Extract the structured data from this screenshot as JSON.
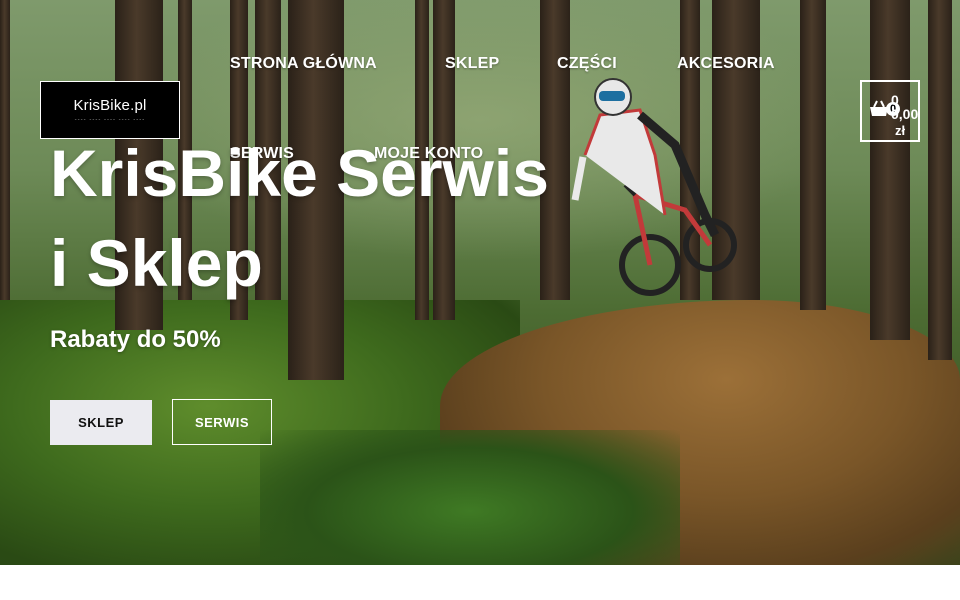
{
  "header": {
    "logo_text": "KrisBike.pl",
    "logo_tagline": "---- ---- ---- ---- ----"
  },
  "nav": {
    "items": [
      {
        "label": "STRONA GŁÓWNA"
      },
      {
        "label": "SKLEP"
      },
      {
        "label": "CZĘŚCI"
      },
      {
        "label": "AKCESORIA"
      },
      {
        "label": "SERWIS"
      },
      {
        "label": "MOJE KONTO"
      }
    ]
  },
  "cart": {
    "count": "0",
    "amount_top": "0",
    "amount": "0,00",
    "currency": "zł",
    "icon": "shopping-basket-icon"
  },
  "hero": {
    "title": "KrisBike Serwis i Sklep",
    "subtitle": "Rabaty do 50%",
    "primary_button": "SKLEP",
    "secondary_button": "SERWIS"
  },
  "colors": {
    "logo_bg": "#000000",
    "primary_button_bg": "#ebebf0",
    "text": "#ffffff"
  }
}
